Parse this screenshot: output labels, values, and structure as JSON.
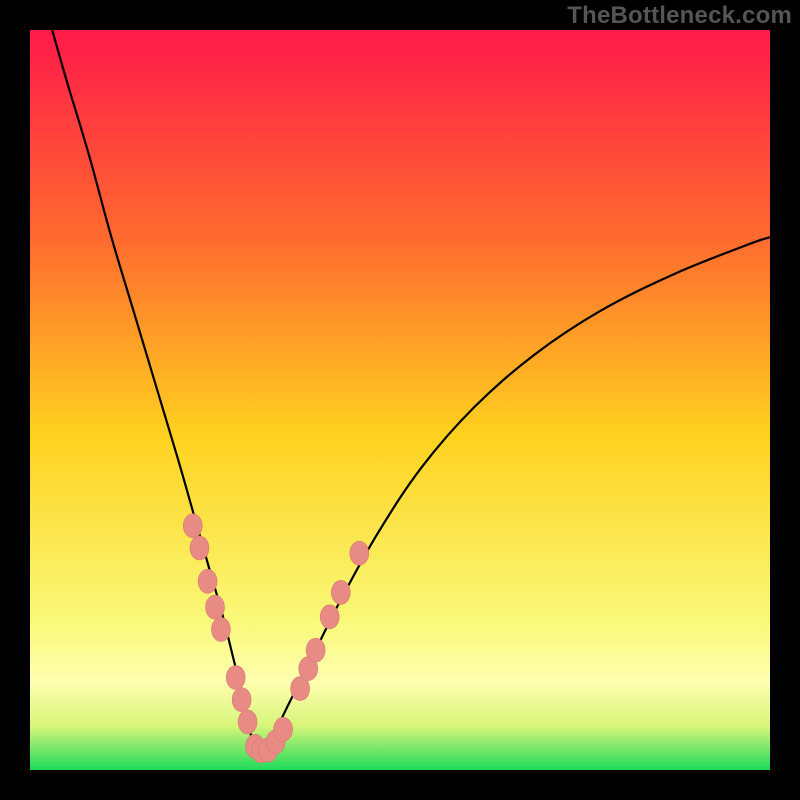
{
  "watermark": "TheBottleneck.com",
  "colors": {
    "gradient_top": "#ff1a4a",
    "gradient_mid_upper": "#ff6a2f",
    "gradient_mid": "#ffd21f",
    "gradient_lower_yellow": "#f9f97a",
    "gradient_pale_band": "#ffffb0",
    "gradient_green": "#1fdc5a",
    "curve_stroke": "#000000",
    "marker_fill": "#e98b85",
    "frame_bg": "#000000"
  },
  "chart_data": {
    "type": "line",
    "title": "",
    "xlabel": "",
    "ylabel": "",
    "xlim": [
      0,
      100
    ],
    "ylim": [
      0,
      100
    ],
    "grid": false,
    "legend": null,
    "series": [
      {
        "name": "left-branch",
        "x": [
          3,
          5,
          8,
          11,
          14,
          17,
          20,
          22,
          24,
          26,
          27.5,
          28.5,
          29.2,
          29.7,
          30,
          30.3,
          30.8
        ],
        "y": [
          100,
          93,
          83,
          72,
          62,
          52,
          42,
          35,
          28,
          21,
          15,
          11,
          8,
          5.5,
          4,
          3,
          2.5
        ]
      },
      {
        "name": "right-branch",
        "x": [
          30.8,
          31.5,
          33,
          35,
          38,
          42,
          47,
          53,
          60,
          68,
          77,
          87,
          97,
          100
        ],
        "y": [
          2.5,
          3,
          5,
          9,
          15,
          23,
          32,
          41,
          49,
          56,
          62,
          67,
          71,
          72
        ]
      }
    ],
    "markers": [
      {
        "x": 22.0,
        "y": 33.0
      },
      {
        "x": 22.9,
        "y": 30.0
      },
      {
        "x": 24.0,
        "y": 25.5
      },
      {
        "x": 25.0,
        "y": 22.0
      },
      {
        "x": 25.8,
        "y": 19.0
      },
      {
        "x": 27.8,
        "y": 12.5
      },
      {
        "x": 28.6,
        "y": 9.5
      },
      {
        "x": 29.4,
        "y": 6.5
      },
      {
        "x": 30.4,
        "y": 3.2
      },
      {
        "x": 31.2,
        "y": 2.6
      },
      {
        "x": 32.2,
        "y": 2.7
      },
      {
        "x": 33.2,
        "y": 3.8
      },
      {
        "x": 34.2,
        "y": 5.5
      },
      {
        "x": 36.5,
        "y": 11.0
      },
      {
        "x": 37.6,
        "y": 13.7
      },
      {
        "x": 38.6,
        "y": 16.2
      },
      {
        "x": 40.5,
        "y": 20.7
      },
      {
        "x": 42.0,
        "y": 24.0
      },
      {
        "x": 44.5,
        "y": 29.3
      }
    ],
    "notes": "Axes carry no tick labels or titles in the source image; values are normalized 0–100 estimates read from geometry. V-shaped bottleneck curve over a vertical red→yellow→green gradient."
  }
}
